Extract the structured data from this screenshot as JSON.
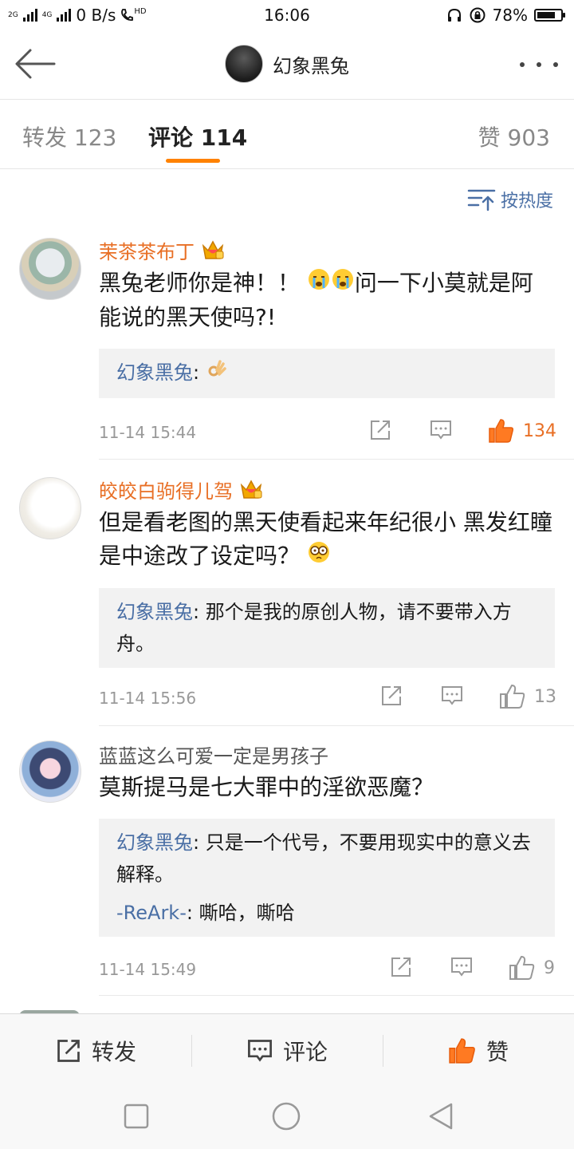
{
  "status_bar": {
    "sim1": "2G",
    "sim2": "4G",
    "net_speed": "0 B/s",
    "hd": "HD",
    "time": "16:06",
    "battery": "78%",
    "battery_level": 0.78
  },
  "header": {
    "title": "幻象黑兔"
  },
  "tabs": [
    {
      "label": "转发 123"
    },
    {
      "label": "评论 114"
    },
    {
      "label": "赞 903"
    }
  ],
  "sort_label": "按热度",
  "comments": [
    {
      "user": "茉茶茶布丁",
      "vip": true,
      "text": "黑兔老师你是神！！",
      "text_tail": "问一下小莫就是阿能说的黑天使吗?!",
      "replies": [
        {
          "name": "幻象黑兔",
          "text": ""
        }
      ],
      "time": "11-14 15:44",
      "likes": "134",
      "liked": true
    },
    {
      "user": "皎皎白驹得儿驾",
      "vip": true,
      "text": "但是看老图的黑天使看起来年纪很小 黑发红瞳 是中途改了设定吗？",
      "replies": [
        {
          "name": "幻象黑兔",
          "text": "那个是我的原创人物，请不要带入方舟。"
        }
      ],
      "time": "11-14 15:56",
      "likes": "13",
      "liked": false
    },
    {
      "user": "蓝蓝这么可爱一定是男孩子",
      "vip": false,
      "text": "莫斯提马是七大罪中的淫欲恶魔？",
      "replies": [
        {
          "name": "幻象黑兔",
          "text": "只是一个代号，不要用现实中的意义去解释。"
        },
        {
          "name": "-ReArk-",
          "text": "嘶哈，嘶哈"
        }
      ],
      "time": "11-14 15:49",
      "likes": "9",
      "liked": false
    }
  ],
  "bottom_bar": {
    "repost": "转发",
    "comment": "评论",
    "like": "赞"
  },
  "colors": {
    "accent": "#ff8200",
    "link": "#4a6fa5",
    "vip_name": "#e86f25"
  }
}
